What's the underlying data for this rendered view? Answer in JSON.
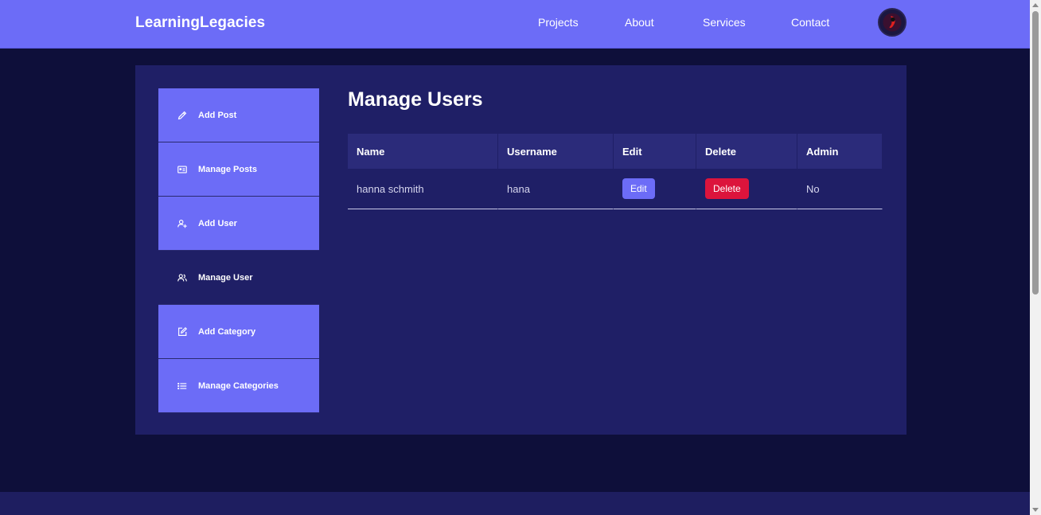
{
  "navbar": {
    "brand": "LearningLegacies",
    "links": [
      "Projects",
      "About",
      "Services",
      "Contact"
    ]
  },
  "sidebar": {
    "items": [
      {
        "label": "Add Post",
        "icon": "pencil-icon"
      },
      {
        "label": "Manage Posts",
        "icon": "posts-card-icon"
      },
      {
        "label": "Add User",
        "icon": "add-user-icon"
      },
      {
        "label": "Manage User",
        "icon": "users-icon",
        "active": true
      },
      {
        "label": "Add Category",
        "icon": "edit-square-icon"
      },
      {
        "label": "Manage Categories",
        "icon": "list-icon"
      }
    ]
  },
  "main": {
    "title": "Manage Users",
    "table": {
      "headers": [
        "Name",
        "Username",
        "Edit",
        "Delete",
        "Admin"
      ],
      "rows": [
        {
          "name": "hanna schmith",
          "username": "hana",
          "edit": "Edit",
          "delete": "Delete",
          "admin": "No"
        }
      ]
    }
  },
  "colors": {
    "accent": "#6c6cf7",
    "danger": "#dc143c",
    "background": "#0e0f3a",
    "panel": "#1f1f66"
  }
}
